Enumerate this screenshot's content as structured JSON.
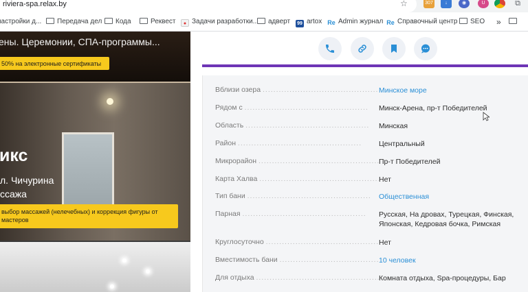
{
  "browser": {
    "url": "riviera-spa.relax.by",
    "extension_badge": "307",
    "bookmarks": [
      {
        "label": "настройки д...",
        "type": "folder"
      },
      {
        "label": "Передача дел",
        "type": "folder"
      },
      {
        "label": "Кода",
        "type": "folder"
      },
      {
        "label": "Реквест",
        "type": "folder"
      },
      {
        "label": "Задачи разработки...",
        "type": "page"
      },
      {
        "label": "адверт",
        "type": "folder"
      },
      {
        "label": "artox",
        "type": "page"
      },
      {
        "label": "Admin журнал",
        "type": "page"
      },
      {
        "label": "Справочный центр",
        "type": "page"
      },
      {
        "label": "SEO",
        "type": "folder"
      }
    ],
    "more_label": "»"
  },
  "left": {
    "card1_text": "ены. Церемонии, СПА-программы...",
    "card1_badge": "50% на электронные сертификаты",
    "card2_title": "икс",
    "card2_sub1": "л. Чичурина",
    "card2_sub2": "ссажа",
    "card2_badge_line1": "выбор массажей (нелечебных) и коррекция фигуры от",
    "card2_badge_line2": "мастеров"
  },
  "actions": [
    "phone-icon",
    "link-icon",
    "bookmark-icon",
    "chat-icon"
  ],
  "colors": {
    "accent": "#6e35b6",
    "link": "#2a8fd6",
    "badge": "#f7c91d"
  },
  "details": [
    {
      "label": "Вблизи озера",
      "value": "Минское море",
      "link": true
    },
    {
      "label": "Рядом с",
      "value": "Минск-Арена, пр-т Победителей",
      "link": false
    },
    {
      "label": "Область",
      "value": "Минская",
      "link": false
    },
    {
      "label": "Район",
      "value": "Центральный",
      "link": false
    },
    {
      "label": "Микрорайон",
      "value": "Пр-т Победителей",
      "link": false
    },
    {
      "label": "Карта Халва",
      "value": "Нет",
      "link": false
    },
    {
      "label": "Тип бани",
      "value": "Общественная",
      "link": true
    },
    {
      "label": "Парная",
      "value": "Русская, На дровах, Турецкая, Финская, Японская, Кедровая бочка, Римская",
      "link": false
    },
    {
      "label": "Круглосуточно",
      "value": "Нет",
      "link": false
    },
    {
      "label": "Вместимость бани",
      "value": "10 человек",
      "link": true
    },
    {
      "label": "Для отдыха",
      "value": "Комната отдыха, Spa-процедуры, Бар",
      "link": false
    }
  ]
}
